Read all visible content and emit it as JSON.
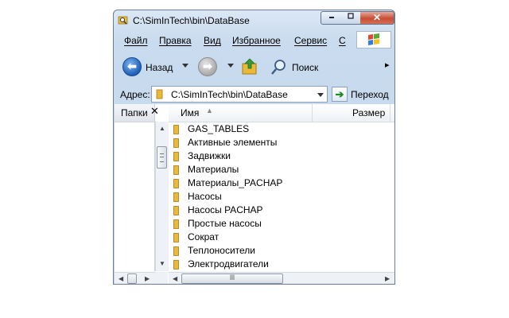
{
  "window": {
    "title": "C:\\SimInTech\\bin\\DataBase",
    "minimize_icon": "minimize-icon",
    "maximize_icon": "maximize-icon",
    "close_label": "✕"
  },
  "menu": {
    "items": [
      "Файл",
      "Правка",
      "Вид",
      "Избранное",
      "Сервис",
      "С"
    ]
  },
  "toolbar": {
    "back_label": "Назад",
    "search_label": "Поиск",
    "more": "▸"
  },
  "address": {
    "label": "Адрес:",
    "value": "C:\\SimInTech\\bin\\DataBase",
    "go_label": "Переход"
  },
  "folders_pane": {
    "label": "Папки",
    "close": "✕"
  },
  "columns": {
    "name": "Имя",
    "size": "Размер"
  },
  "files": [
    "GAS_TABLES",
    "Активные элементы",
    "Задвижки",
    "Материалы",
    "Материалы_PACHAP",
    "Насосы",
    "Насосы PACHAP",
    "Простые насосы",
    "Сократ",
    "Теплоносители",
    "Электродвигатели"
  ],
  "colors": {
    "folder": "#e8b93a",
    "selection_bg": "#ffffff",
    "accent": "#1f5fb6"
  }
}
